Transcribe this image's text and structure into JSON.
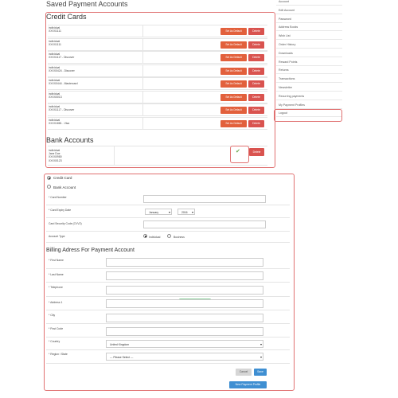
{
  "page_title": "Saved Payment Accounts",
  "credit_cards": {
    "title": "Credit Cards",
    "set_default_label": "Set As Default",
    "delete_label": "Delete",
    "items": [
      {
        "line1": "individual",
        "line2": "XXXX1111"
      },
      {
        "line1": "individual",
        "line2": "XXXX1111"
      },
      {
        "line1": "individual",
        "line2": "XXXX1117 - Discover"
      },
      {
        "line1": "individual",
        "line2": "XXXX0424 - Discover"
      },
      {
        "line1": "individual",
        "line2": "XXXX0444 - Mastercard"
      },
      {
        "line1": "individual",
        "line2": "XXXX0013"
      },
      {
        "line1": "individual",
        "line2": "XXXX1117 - Discover"
      },
      {
        "line1": "individual",
        "line2": "XXXX1881 - Visa"
      }
    ]
  },
  "bank_accounts": {
    "title": "Bank Accounts",
    "delete_label": "Delete",
    "item": {
      "line1": "individual",
      "line2": "Jane Doe",
      "line3": "XXXX0980",
      "line4": "XXXX0123"
    }
  },
  "sidebar": {
    "items": [
      "Account",
      "Edit Account",
      "Password",
      "Address Books",
      "Wish List",
      "Order History",
      "Downloads",
      "Reward Points",
      "Returns",
      "Transactions",
      "Newsletter",
      "Recurring payments",
      "My Payment Profiles",
      "Logout"
    ]
  },
  "form": {
    "type_credit": "Credit Card",
    "type_bank": "Bank Account",
    "card_number_label": "* Card Number",
    "expiry_label": "* Card Expiry Date",
    "expiry_month": "January",
    "expiry_year": "2016",
    "cvv_label": "Card Security Code (CVV2)",
    "account_type_label": "Account Type",
    "account_individual": "Individual",
    "account_business": "Business",
    "billing_title": "Billing Adress For Payment Account",
    "first_name": "* First Name",
    "last_name": "* Last Name",
    "telephone": "* Telephone",
    "address1": "* Address 1",
    "city": "* City",
    "post_code": "* Post Code",
    "country_label": "* Country",
    "country_value": "United Kingdom",
    "region_label": "* Region / State",
    "region_value": " --- Please Select --- ",
    "cancel_label": "Cancel",
    "save_label": "Save",
    "new_profile_label": "New Payment Profile"
  }
}
